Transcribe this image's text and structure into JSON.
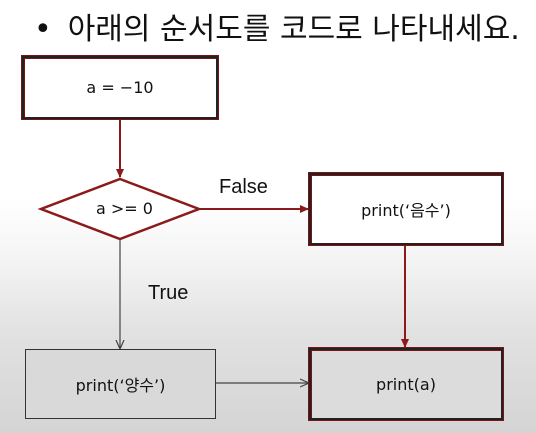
{
  "slide": {
    "bullet": "•",
    "title": "아래의 순서도를 코드로 나타내세요."
  },
  "flowchart": {
    "start": "a = −10",
    "condition": "a >= 0",
    "false_label": "False",
    "true_label": "True",
    "false_branch": "print(‘음수’)",
    "true_branch": "print(‘양수’)",
    "end": "print(a)"
  },
  "colors": {
    "arrow_dark_red": "#8b1a1a",
    "arrow_grey": "#555555",
    "box_border": "#222222",
    "grey_box_fill": "#d9d9d9"
  }
}
